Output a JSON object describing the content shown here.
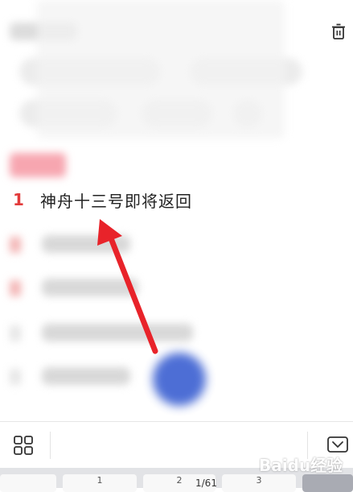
{
  "trending": {
    "top_item": {
      "rank": "1",
      "title": "神舟十三号即将返回"
    }
  },
  "pager": {
    "keys": [
      "1",
      "2",
      "3"
    ],
    "page_label": "1/61"
  },
  "watermark": {
    "text": "Baidu经验"
  },
  "colors": {
    "rank_red": "#e23b3b",
    "hot_tag_pink": "#f7a6b0",
    "fab_blue": "#3a5fd1",
    "arrow_red": "#e8232a"
  },
  "icons": {
    "trash": "trash-icon",
    "grid": "grid-icon",
    "collapse": "chevron-down-icon"
  }
}
